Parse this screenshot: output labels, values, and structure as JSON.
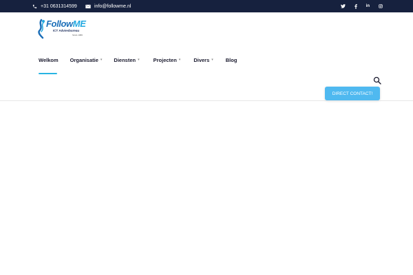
{
  "topbar": {
    "phone": "+31 0631314599",
    "email": "info@followme.nl",
    "social": [
      "twitter-icon",
      "facebook-icon",
      "linkedin-icon",
      "instagram-icon"
    ],
    "background": "#16213e"
  },
  "logo": {
    "word_a": "Follow",
    "word_b": "ME",
    "tagline": "ICT Adviesbureau",
    "since": "Sinds 1986"
  },
  "nav": {
    "items": [
      {
        "label": "Welkom",
        "active": true,
        "has_submenu": false
      },
      {
        "label": "Organisatie",
        "active": false,
        "has_submenu": true
      },
      {
        "label": "Diensten",
        "active": false,
        "has_submenu": true
      },
      {
        "label": "Projecten",
        "active": false,
        "has_submenu": true
      },
      {
        "label": "Divers",
        "active": false,
        "has_submenu": true
      },
      {
        "label": "Blog",
        "active": false,
        "has_submenu": false
      }
    ],
    "accent": "#28b4e3"
  },
  "cta": {
    "label": "DIRECT CONTACT!",
    "color": "#4fb9f0"
  }
}
